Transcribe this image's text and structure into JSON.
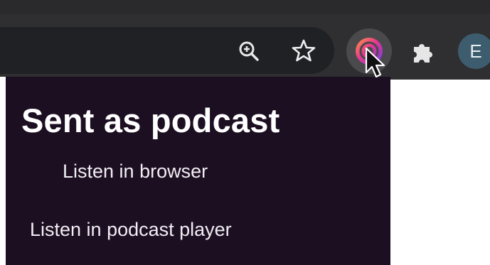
{
  "toolbar": {
    "icons": {
      "zoom": "zoom-in-icon",
      "bookmark": "star-icon",
      "active_extension": "podcast-extension-icon",
      "extensions": "puzzle-icon"
    },
    "profile_initial": "E"
  },
  "popup": {
    "title": "Sent as podcast",
    "listen_browser": "Listen in browser",
    "listen_player": "Listen in podcast player"
  },
  "colors": {
    "popup_bg": "#1c0f22",
    "toolbar_bg": "#2f2f31",
    "omnibox_bg": "#202124",
    "avatar_bg": "#3d5d6f"
  }
}
